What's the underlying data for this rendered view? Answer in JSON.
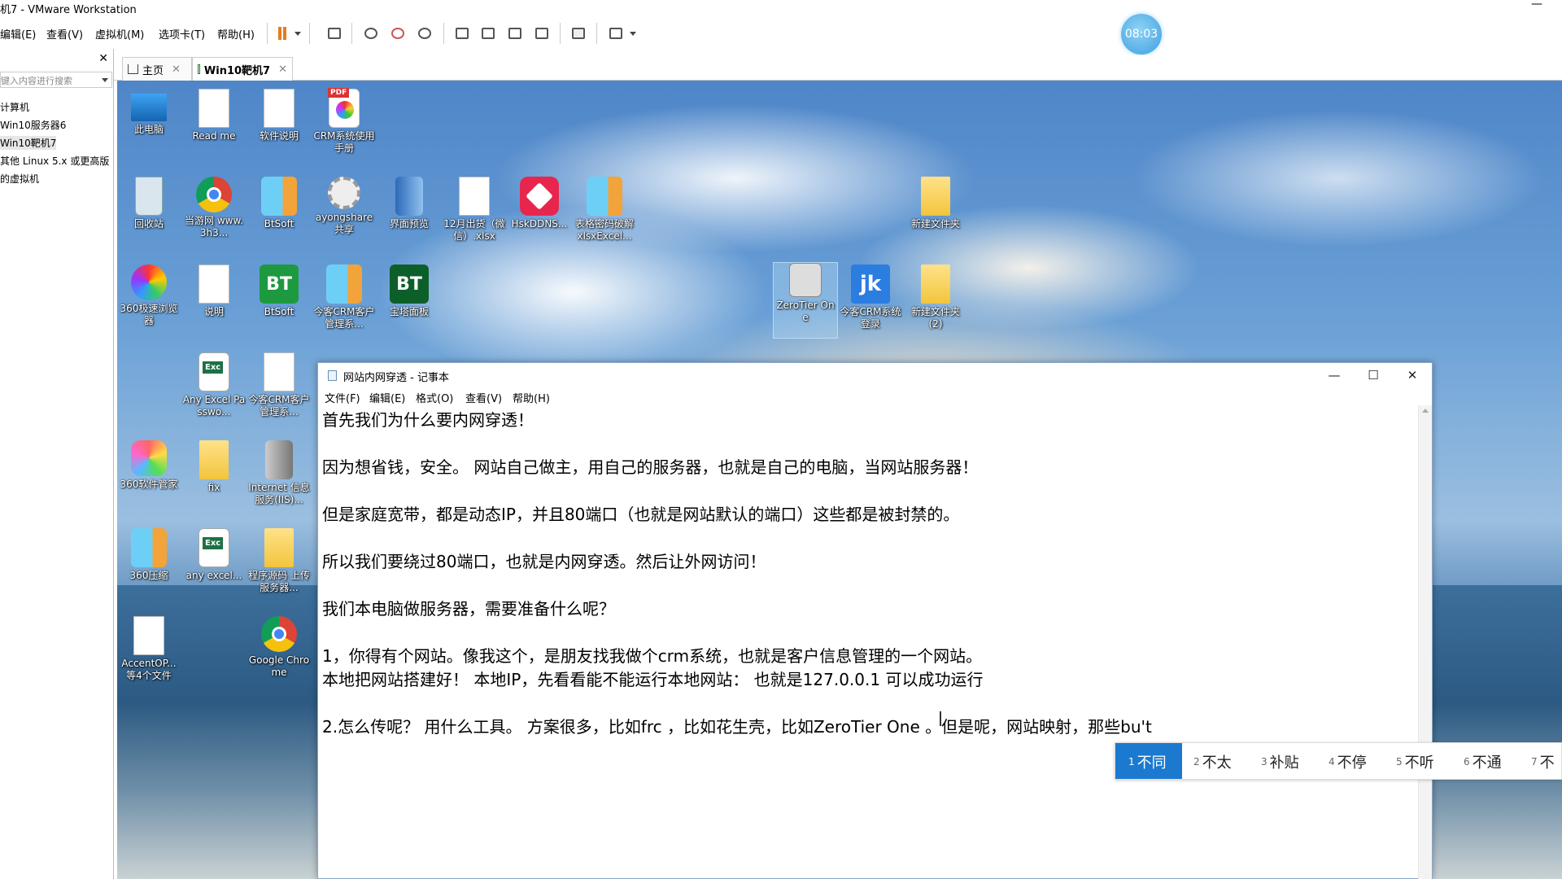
{
  "vmware": {
    "title": "机7 - VMware Workstation",
    "menu": [
      "编辑(E)",
      "查看(V)",
      "虚拟机(M)",
      "选项卡(T)",
      "帮助(H)"
    ],
    "clock": "08:03"
  },
  "library": {
    "search_placeholder": "键入内容进行搜索",
    "items": [
      "计算机",
      "Win10服务器6",
      "Win10靶机7",
      "其他 Linux 5.x 或更高版",
      "的虚拟机"
    ]
  },
  "tabs": [
    {
      "label": "主页"
    },
    {
      "label": "Win10靶机7"
    }
  ],
  "desktop_icons": [
    {
      "label": "此电脑",
      "icon": "computer-icon"
    },
    {
      "label": "Read me",
      "icon": "document-icon"
    },
    {
      "label": "软件说明",
      "icon": "document-icon"
    },
    {
      "label": "CRM系统使用手册",
      "icon": "pdf-icon"
    },
    {
      "label": "回收站",
      "icon": "recycle-bin-icon"
    },
    {
      "label": "当游网 www.3h3...",
      "icon": "chrome-icon"
    },
    {
      "label": "BtSoft",
      "icon": "zip-icon"
    },
    {
      "label": "ayongshare 共享",
      "icon": "gear-icon"
    },
    {
      "label": "界面预览",
      "icon": "book-icon"
    },
    {
      "label": "12月出货（微信）.xlsx",
      "icon": "document-icon"
    },
    {
      "label": "HskDDNS...",
      "icon": "hskddns-icon"
    },
    {
      "label": "表格密码破解xlsxExcel...",
      "icon": "zip-icon"
    },
    {
      "label": "新建文件夹",
      "icon": "folder-icon"
    },
    {
      "label": "360极速浏览器",
      "icon": "browser-360-icon"
    },
    {
      "label": "说明",
      "icon": "document-icon"
    },
    {
      "label": "BtSoft",
      "icon": "bt-icon"
    },
    {
      "label": "今客CRM客户管理系...",
      "icon": "zip-icon"
    },
    {
      "label": "宝塔面板",
      "icon": "bt-icon"
    },
    {
      "label": "ZeroTier One",
      "icon": "zerotier-icon"
    },
    {
      "label": "今客CRM系统登录",
      "icon": "jk-icon"
    },
    {
      "label": "新建文件夹 (2)",
      "icon": "folder-icon"
    },
    {
      "label": "Any Excel Passwo...",
      "icon": "excel-icon"
    },
    {
      "label": "今客CRM客户管理系...",
      "icon": "document-icon"
    },
    {
      "label": "360软件管家",
      "icon": "soft-360-icon"
    },
    {
      "label": "fix",
      "icon": "folder-icon"
    },
    {
      "label": "Internet 信息服务(IIS)...",
      "icon": "server-icon"
    },
    {
      "label": "360压缩",
      "icon": "zip-icon"
    },
    {
      "label": "any excel...",
      "icon": "excel-icon"
    },
    {
      "label": "程序源码 上传服务器...",
      "icon": "folder-icon"
    },
    {
      "label": "AccentOP... 等4个文件",
      "icon": "document-icon"
    },
    {
      "label": "Google Chrome",
      "icon": "chrome-icon"
    }
  ],
  "notepad": {
    "title": "网站内网穿透 - 记事本",
    "menu": [
      "文件(F)",
      "编辑(E)",
      "格式(O)",
      "查看(V)",
      "帮助(H)"
    ],
    "lines": [
      "首先我们为什么要内网穿透！",
      "因为想省钱，安全。 网站自己做主，用自己的服务器，也就是自己的电脑，当网站服务器！",
      "但是家庭宽带，都是动态IP，并且80端口（也就是网站默认的端口）这些都是被封禁的。",
      "所以我们要绕过80端口，也就是内网穿透。然后让外网访问！",
      "我们本电脑做服务器，需要准备什么呢？",
      "1，你得有个网站。像我这个，是朋友找我做个crm系统，也就是客户信息管理的一个网站。",
      "本地把网站搭建好！ 本地IP，先看看能不能运行本地网站： 也就是127.0.0.1   可以成功运行",
      "2.怎么传呢？ 用什么工具。 方案很多，比如frc ，比如花生壳，比如ZeroTier One 。但是呢，网站映射，那些bu't"
    ]
  },
  "ime": {
    "candidates": [
      {
        "n": "1",
        "text": "不同"
      },
      {
        "n": "2",
        "text": "不太"
      },
      {
        "n": "3",
        "text": "补贴"
      },
      {
        "n": "4",
        "text": "不停"
      },
      {
        "n": "5",
        "text": "不听"
      },
      {
        "n": "6",
        "text": "不通"
      },
      {
        "n": "7",
        "text": "不"
      }
    ]
  },
  "colors": {
    "accent": "#1b79d0",
    "pause": "#e57d1f"
  }
}
